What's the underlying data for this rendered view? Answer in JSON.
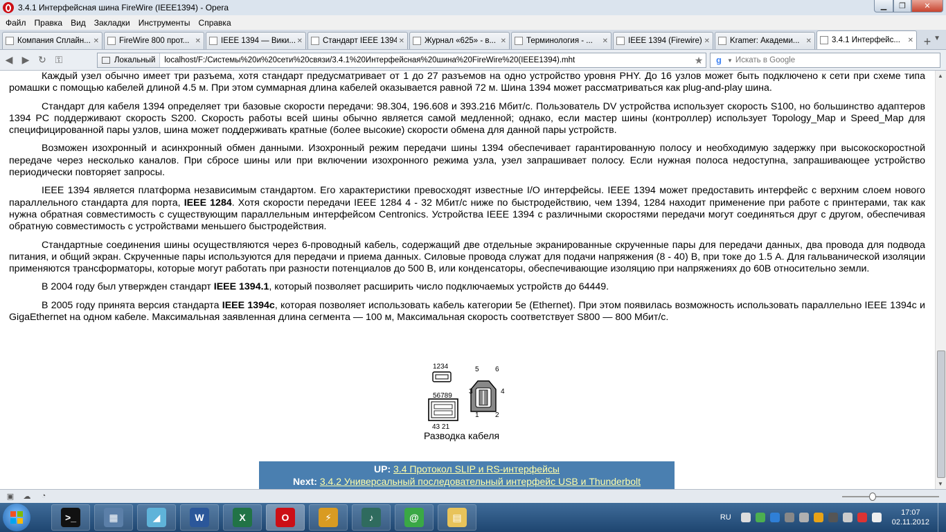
{
  "window": {
    "title": "3.4.1 Интерфейсная шина FireWire (IEEE1394) - Opera"
  },
  "menu": [
    "Файл",
    "Правка",
    "Вид",
    "Закладки",
    "Инструменты",
    "Справка"
  ],
  "tabs": [
    {
      "label": "Компания Сплайн..."
    },
    {
      "label": "FireWire 800 прот..."
    },
    {
      "label": "IEEE 1394 — Вики..."
    },
    {
      "label": "Стандарт IEEE 1394"
    },
    {
      "label": "Журнал «625» - в..."
    },
    {
      "label": "Терминология - ..."
    },
    {
      "label": "IEEE 1394 (Firewire)"
    },
    {
      "label": "Kramer: Академи..."
    },
    {
      "label": "3.4.1 Интерфейс..."
    }
  ],
  "address": {
    "location_label": "Локальный",
    "url": "localhost/F:/Системы%20и%20сети%20связи/3.4.1%20Интерфейсная%20шина%20FireWire%20(IEEE1394).mht"
  },
  "search": {
    "placeholder": "Искать в Google"
  },
  "paragraphs": [
    {
      "parts": [
        {
          "t": "Каждый узел обычно имеет три разъема, хотя стандарт предусматривает от 1 до 27 разъемов на одно устройство уровня PHY. До 16 узлов может быть подключено к сети при схеме типа ромашки с помощью кабелей длиной 4.5 м. При этом суммарная длина кабелей оказывается равной 72 м. Шина 1394 может рассматриваться как plug-and-play шина."
        }
      ]
    },
    {
      "parts": [
        {
          "t": "Стандарт для кабеля 1394 определяет три базовые скорости передачи: 98.304, 196.608 и 393.216 Мбит/с. Пользователь DV устройства использует скорость S100, но большинство адаптеров 1394 PC поддерживают скорость S200. Скорость работы всей шины обычно является самой медленной; однако, если мастер шины (контроллер) использует Topology_Map и Speed_Map для специфицированной пары узлов, шина может поддерживать кратные (более высокие) скорости обмена для данной пары устройств."
        }
      ]
    },
    {
      "parts": [
        {
          "t": "Возможен изохронный и асинхронный обмен данными. Изохронный режим передачи шины 1394 обеспечивает гарантированную полосу и необходимую задержку при высокоскоростной передаче через несколько каналов. При сбросе шины или при включении изохронного режима узла, узел запрашивает полосу. Если нужная полоса недоступна, запрашивающее устройство периодически повторяет запросы."
        }
      ]
    },
    {
      "parts": [
        {
          "t": "IEEE 1394 является платформа независимым стандартом. Его характеристики превосходят известные I/O интерфейсы. IEEE 1394 может предоставить интерфейс с верхним слоем нового параллельного стандарта для порта, "
        },
        {
          "t": "IEEE 1284",
          "b": true
        },
        {
          "t": ". Хотя скорости передачи IEEE 1284 4 - 32 Мбит/с ниже по быстродействию, чем 1394, 1284 находит применение при работе с принтерами, так как нужна обратная совместимость с существующим параллельным интерфейсом Centronics. Устройства IEEE 1394 с различными скоростями передачи могут соединяться друг с другом, обеспечивая обратную совместимость с устройствами меньшего быстродействия."
        }
      ]
    },
    {
      "parts": [
        {
          "t": "Стандартные соединения шины осуществляются через 6-проводный кабель, содержащий две отдельные экранированные скрученные пары для передачи данных, два провода для подвода питания, и общий экран. Скрученные пары используются для передачи и приема данных. Силовые провода служат для подачи напряжения (8 - 40) В, при токе до 1.5 А. Для гальванической изоляции применяются трансформаторы, которые могут работать при разности потенциалов до 500 В, или конденсаторы, обеспечивающие изоляцию при напряжениях до 60В относительно земли."
        }
      ]
    },
    {
      "parts": [
        {
          "t": "В 2004 году был утвержден стандарт "
        },
        {
          "t": "IEEE 1394.1",
          "b": true
        },
        {
          "t": ", который позволяет расширить число подключаемых устройств до 64449."
        }
      ]
    },
    {
      "parts": [
        {
          "t": "В 2005 году принята версия стандарта "
        },
        {
          "t": "IEEE 1394c",
          "b": true
        },
        {
          "t": ", которая позволяет использовать кабель категории 5e (Ethernet). При этом появилась возможность использовать параллельно IEEE 1394c и GigaEthernet на одном кабеле. Максимальная заявленная длина сегмента — 100 м, Максимальная скорость соответствует S800 — 800 Мбит/с."
        }
      ]
    }
  ],
  "figure": {
    "label_top_small": "1234",
    "label_mid": "56789",
    "label_bottom": "43 21",
    "pin5": "5",
    "pin6": "6",
    "pin3": "3",
    "pin4": "4",
    "pin1": "1",
    "pin2": "2",
    "caption": "Разводка кабеля"
  },
  "nav": {
    "up_label": "UP:",
    "up_link": "3.4 Протокол SLIP и RS-интерфейсы",
    "next_label": "Next:",
    "next_link": "3.4.2 Универсальный последовательный интерфейс USB и Thunderbolt"
  },
  "status": {
    "zoom_fraction": 0.3
  },
  "taskbar": {
    "apps": [
      {
        "name": "cmd",
        "glyph": ">_",
        "color": "#111111"
      },
      {
        "name": "calculator",
        "glyph": "▦",
        "color": "#5b7fa8"
      },
      {
        "name": "notes",
        "glyph": "◢",
        "color": "#5fb3d9"
      },
      {
        "name": "word",
        "glyph": "W",
        "color": "#2b579a"
      },
      {
        "name": "excel",
        "glyph": "X",
        "color": "#217346"
      },
      {
        "name": "opera",
        "glyph": "O",
        "color": "#cc0f16"
      },
      {
        "name": "winamp",
        "glyph": "⚡",
        "color": "#d99b22"
      },
      {
        "name": "music",
        "glyph": "♪",
        "color": "#2f6b5e"
      },
      {
        "name": "icq",
        "glyph": "@",
        "color": "#3aa845"
      },
      {
        "name": "explorer",
        "glyph": "▤",
        "color": "#e8c35a"
      }
    ],
    "lang": "RU",
    "time": "17:07",
    "date": "02.11.2012"
  }
}
